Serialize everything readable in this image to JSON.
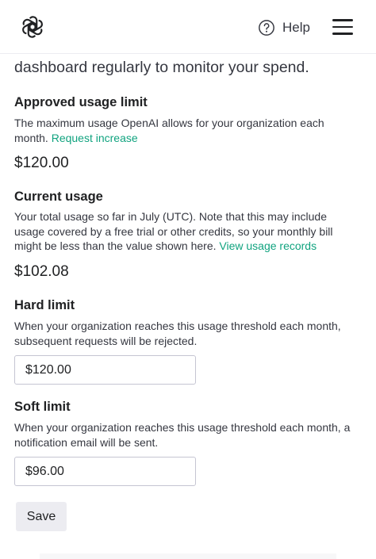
{
  "header": {
    "help_label": "Help"
  },
  "intro_text": "dashboard regularly to monitor your spend.",
  "approved_limit": {
    "heading": "Approved usage limit",
    "description": "The maximum usage OpenAI allows for your organization each month. ",
    "link": "Request increase",
    "value": "$120.00"
  },
  "current_usage": {
    "heading": "Current usage",
    "description": "Your total usage so far in July (UTC). Note that this may include usage covered by a free trial or other credits, so your monthly bill might be less than the value shown here. ",
    "link": "View usage records",
    "value": "$102.08"
  },
  "hard_limit": {
    "heading": "Hard limit",
    "description": "When your organization reaches this usage threshold each month, subsequent requests will be rejected.",
    "input_value": "$120.00"
  },
  "soft_limit": {
    "heading": "Soft limit",
    "description": "When your organization reaches this usage threshold each month, a notification email will be sent.",
    "input_value": "$96.00"
  },
  "save_label": "Save",
  "colors": {
    "link": "#10a37f",
    "button_bg": "#ececf1",
    "text": "#202123"
  }
}
